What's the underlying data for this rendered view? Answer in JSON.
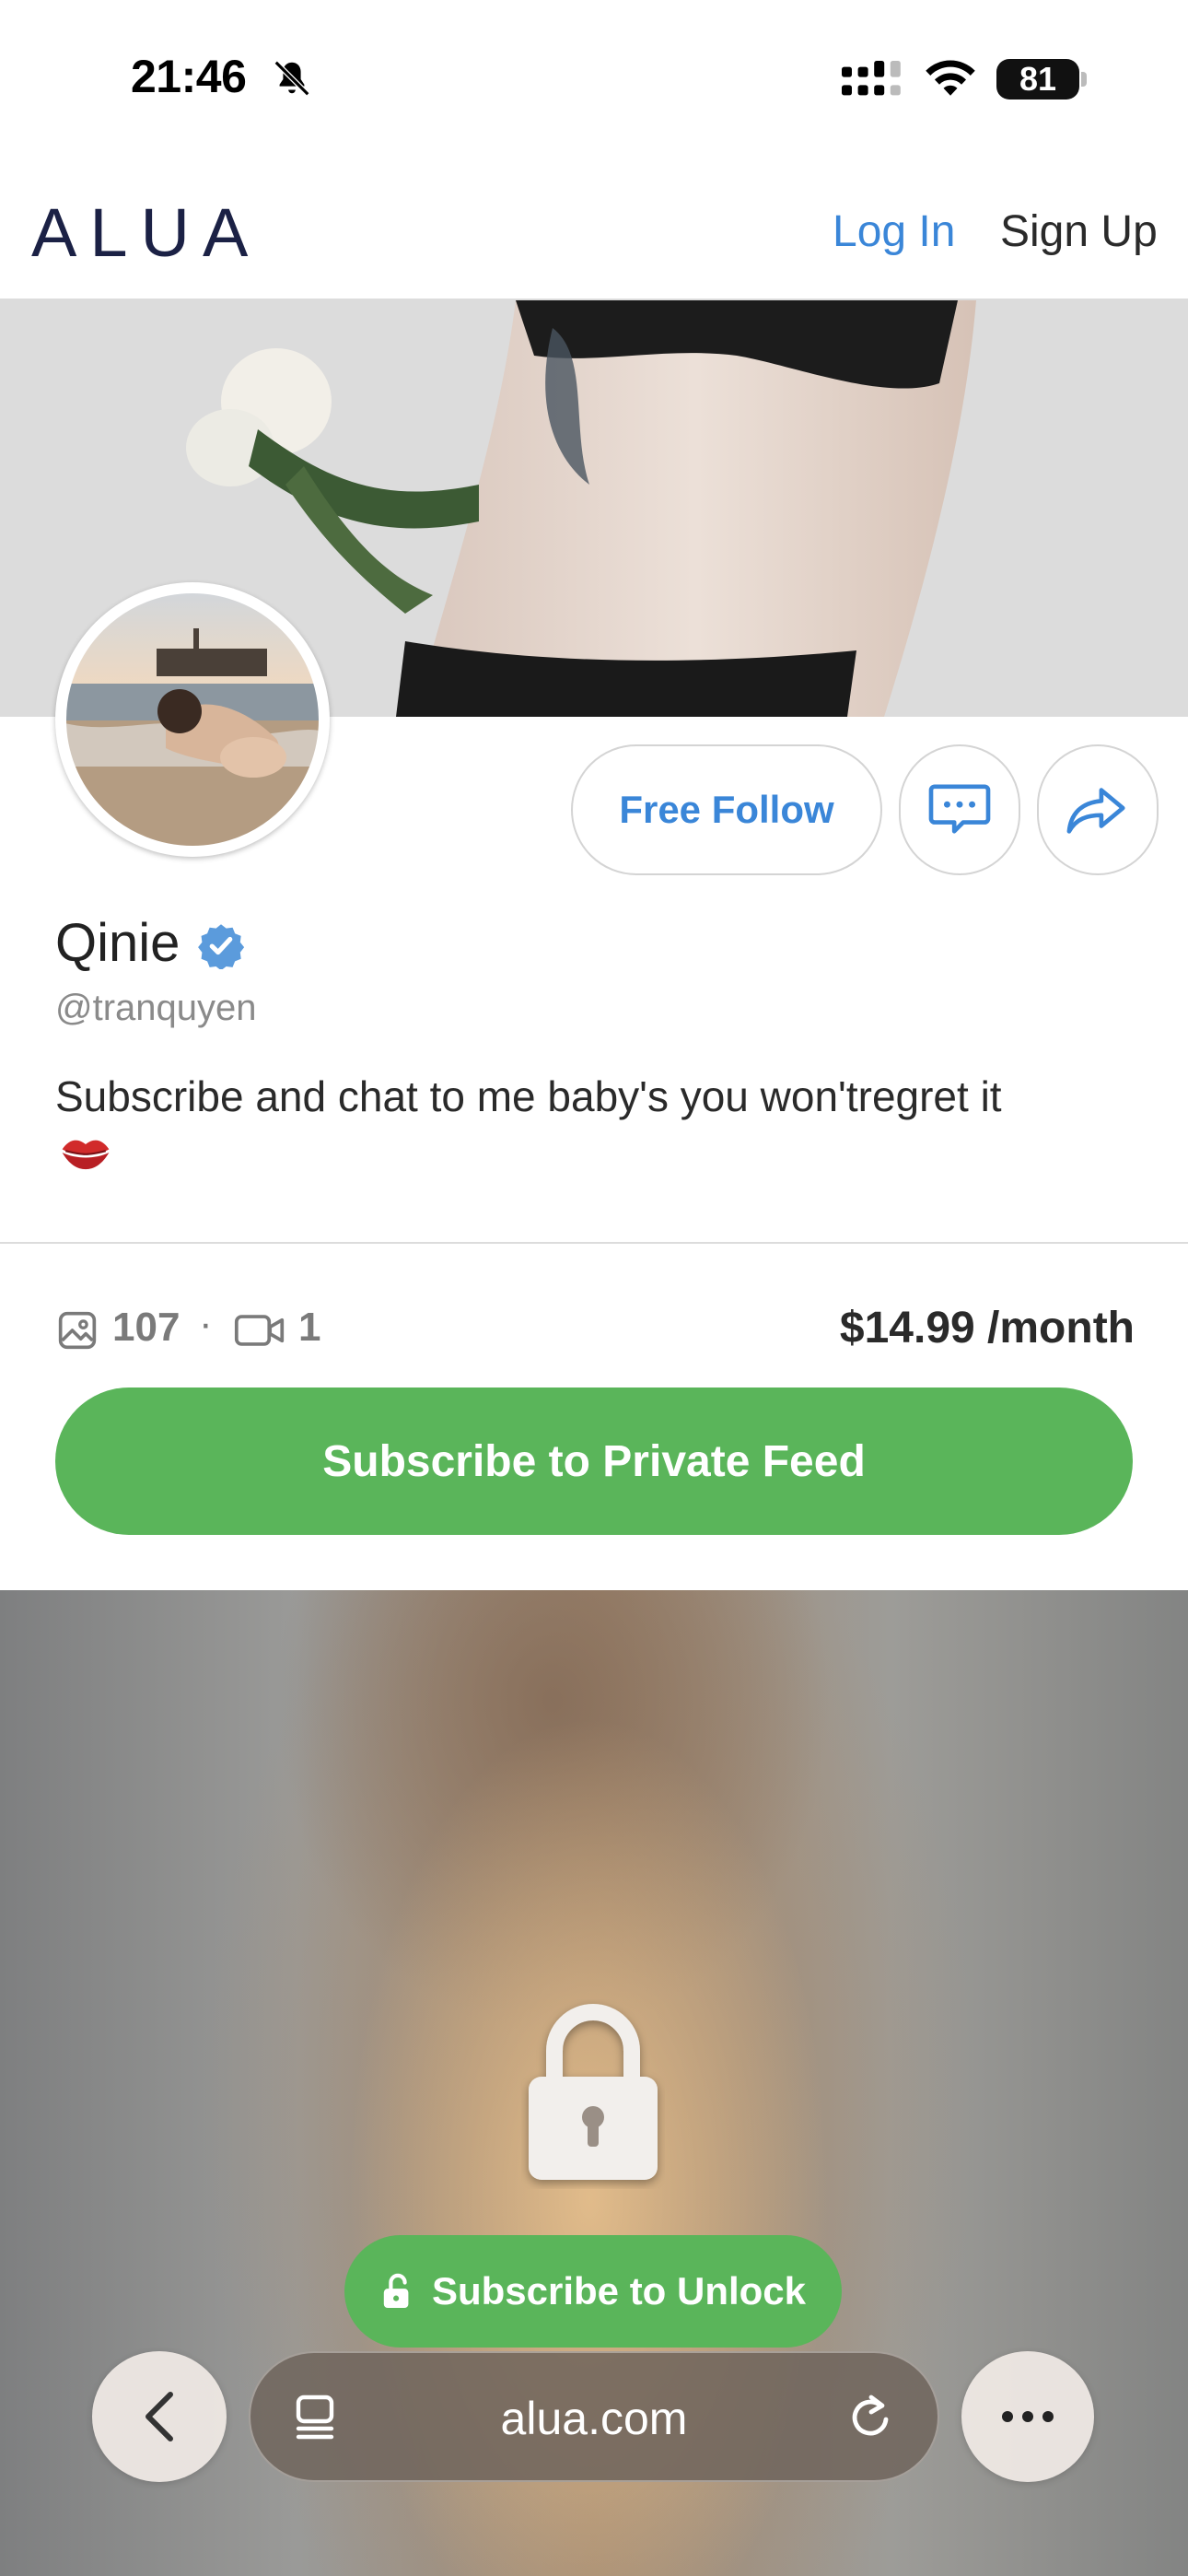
{
  "status_bar": {
    "time": "21:46",
    "battery": "81"
  },
  "header": {
    "logo": "ALUA",
    "login": "Log In",
    "signup": "Sign Up"
  },
  "profile": {
    "name": "Qinie",
    "username": "@tranquyen",
    "bio": "Subscribe and chat to me baby's you won'tregret it"
  },
  "actions": {
    "follow": "Free Follow"
  },
  "stats": {
    "photos": "107",
    "separator": "·",
    "videos": "1",
    "price": "$14.99 /month"
  },
  "subscribe": {
    "label": "Subscribe to Private Feed"
  },
  "locked": {
    "unlock_label": "Subscribe to Unlock"
  },
  "browser": {
    "url": "alua.com"
  },
  "colors": {
    "brand_green": "#5ab55a",
    "link_blue": "#3a86d8",
    "logo_navy": "#1b2145"
  }
}
